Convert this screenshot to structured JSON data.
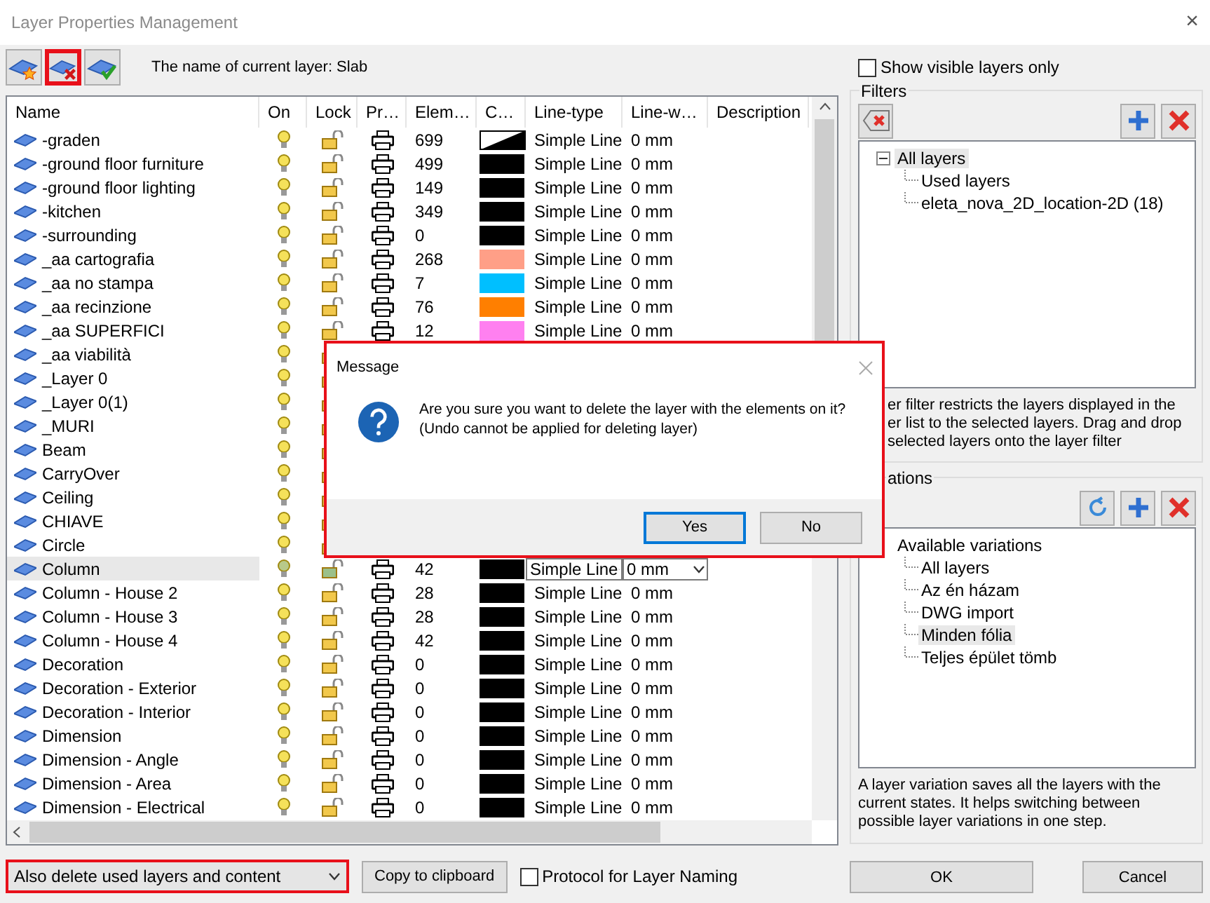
{
  "window": {
    "title": "Layer Properties Management",
    "close": "×"
  },
  "toolbar": {
    "buttons": [
      {
        "kind": "add",
        "highlighted": false
      },
      {
        "kind": "delete",
        "highlighted": true
      },
      {
        "kind": "set-current",
        "highlighted": false
      }
    ],
    "current_layer": "The name of current layer: Slab"
  },
  "table": {
    "columns": [
      "Name",
      "On",
      "Lock",
      "Pr…",
      "Elem…",
      "C…",
      "Line-type",
      "Line-w…",
      "Description"
    ],
    "rows": [
      {
        "name": "-graden",
        "elements": "699",
        "kind": "gradient",
        "line_type": "Simple Line",
        "line_width": "0 mm",
        "selected": false
      },
      {
        "name": "-ground floor furniture",
        "elements": "499",
        "kind": "solid",
        "color": "#000000",
        "line_type": "Simple Line",
        "line_width": "0 mm",
        "selected": false
      },
      {
        "name": "-ground floor lighting",
        "elements": "149",
        "kind": "solid",
        "color": "#000000",
        "line_type": "Simple Line",
        "line_width": "0 mm",
        "selected": false
      },
      {
        "name": "-kitchen",
        "elements": "349",
        "kind": "solid",
        "color": "#000000",
        "line_type": "Simple Line",
        "line_width": "0 mm",
        "selected": false
      },
      {
        "name": "-surrounding",
        "elements": "0",
        "kind": "solid",
        "color": "#000000",
        "line_type": "Simple Line",
        "line_width": "0 mm",
        "selected": false
      },
      {
        "name": "_aa cartografia",
        "elements": "268",
        "kind": "solid",
        "color": "#ff9f87",
        "line_type": "Simple Line",
        "line_width": "0 mm",
        "selected": false
      },
      {
        "name": "_aa no stampa",
        "elements": "7",
        "kind": "solid",
        "color": "#00bfff",
        "line_type": "Simple Line",
        "line_width": "0 mm",
        "selected": false
      },
      {
        "name": "_aa recinzione",
        "elements": "76",
        "kind": "solid",
        "color": "#ff7f00",
        "line_type": "Simple Line",
        "line_width": "0 mm",
        "selected": false
      },
      {
        "name": "_aa SUPERFICI",
        "elements": "12",
        "kind": "solid",
        "color": "#ff80f0",
        "line_type": "Simple Line",
        "line_width": "0 mm",
        "selected": false
      },
      {
        "name": "_aa viabilità",
        "selected": false
      },
      {
        "name": "_Layer 0",
        "selected": false
      },
      {
        "name": "_Layer 0(1)",
        "selected": false
      },
      {
        "name": "_MURI",
        "selected": false
      },
      {
        "name": "Beam",
        "selected": false
      },
      {
        "name": "CarryOver",
        "selected": false
      },
      {
        "name": "Ceiling",
        "selected": false
      },
      {
        "name": "CHIAVE",
        "selected": false
      },
      {
        "name": "Circle",
        "selected": false
      },
      {
        "name": "Column",
        "elements": "42",
        "kind": "solid",
        "color": "#000000",
        "line_type": "Simple Line",
        "line_width": "0 mm",
        "selected": true
      },
      {
        "name": "Column - House 2",
        "elements": "28",
        "kind": "solid",
        "color": "#000000",
        "line_type": "Simple Line",
        "line_width": "0 mm",
        "selected": false
      },
      {
        "name": "Column - House 3",
        "elements": "28",
        "kind": "solid",
        "color": "#000000",
        "line_type": "Simple Line",
        "line_width": "0 mm",
        "selected": false
      },
      {
        "name": "Column - House 4",
        "elements": "42",
        "kind": "solid",
        "color": "#000000",
        "line_type": "Simple Line",
        "line_width": "0 mm",
        "selected": false
      },
      {
        "name": "Decoration",
        "elements": "0",
        "kind": "solid",
        "color": "#000000",
        "line_type": "Simple Line",
        "line_width": "0 mm",
        "selected": false
      },
      {
        "name": "Decoration - Exterior",
        "elements": "0",
        "kind": "solid",
        "color": "#000000",
        "line_type": "Simple Line",
        "line_width": "0 mm",
        "selected": false
      },
      {
        "name": "Decoration - Interior",
        "elements": "0",
        "kind": "solid",
        "color": "#000000",
        "line_type": "Simple Line",
        "line_width": "0 mm",
        "selected": false
      },
      {
        "name": "Dimension",
        "elements": "0",
        "kind": "solid",
        "color": "#000000",
        "line_type": "Simple Line",
        "line_width": "0 mm",
        "selected": false
      },
      {
        "name": "Dimension - Angle",
        "elements": "0",
        "kind": "solid",
        "color": "#000000",
        "line_type": "Simple Line",
        "line_width": "0 mm",
        "selected": false
      },
      {
        "name": "Dimension - Area",
        "elements": "0",
        "kind": "solid",
        "color": "#000000",
        "line_type": "Simple Line",
        "line_width": "0 mm",
        "selected": false
      },
      {
        "name": "Dimension - Electrical",
        "elements": "0",
        "kind": "solid",
        "color": "#000000",
        "line_type": "Simple Line",
        "line_width": "0 mm",
        "selected": false
      }
    ]
  },
  "bottom": {
    "delete_mode": {
      "value": "Also delete used layers and content",
      "highlighted": true
    },
    "copy_button": "Copy to clipboard",
    "protocol": {
      "label": "Protocol for Layer Naming",
      "checked": false
    }
  },
  "show_visible": {
    "label": "Show visible layers only",
    "checked": false
  },
  "filters": {
    "label": "Filters",
    "tree": [
      {
        "label": "All layers",
        "expanded": true,
        "selected": true,
        "children": [
          {
            "label": "Used layers",
            "selected": false
          },
          {
            "label": "eleta_nova_2D_location-2D (18)",
            "selected": false
          }
        ]
      }
    ],
    "description": [
      "er filter restricts the layers displayed in the",
      "er list to the selected layers. Drag and drop",
      "selected layers onto the layer filter"
    ]
  },
  "variations": {
    "label": "ations",
    "tree": [
      {
        "label": "Available variations",
        "selected": false,
        "children": [
          {
            "label": "All layers",
            "selected": false
          },
          {
            "label": "Az én házam",
            "selected": false
          },
          {
            "label": "DWG import",
            "selected": false
          },
          {
            "label": "Minden fólia",
            "selected": true
          },
          {
            "label": "Teljes épület tömb",
            "selected": false
          }
        ]
      }
    ],
    "description": "A layer variation saves all the layers with the current states. It helps switching between possible layer variations in one step."
  },
  "buttons": [
    "OK",
    "Cancel"
  ],
  "dialog": {
    "title": "Message",
    "message": "Are you sure you want to delete the layer with the elements on it?",
    "note": "(Undo cannot be applied for deleting layer)",
    "buttons": [
      {
        "label": "Yes",
        "focused": true
      },
      {
        "label": "No",
        "focused": false
      }
    ]
  }
}
